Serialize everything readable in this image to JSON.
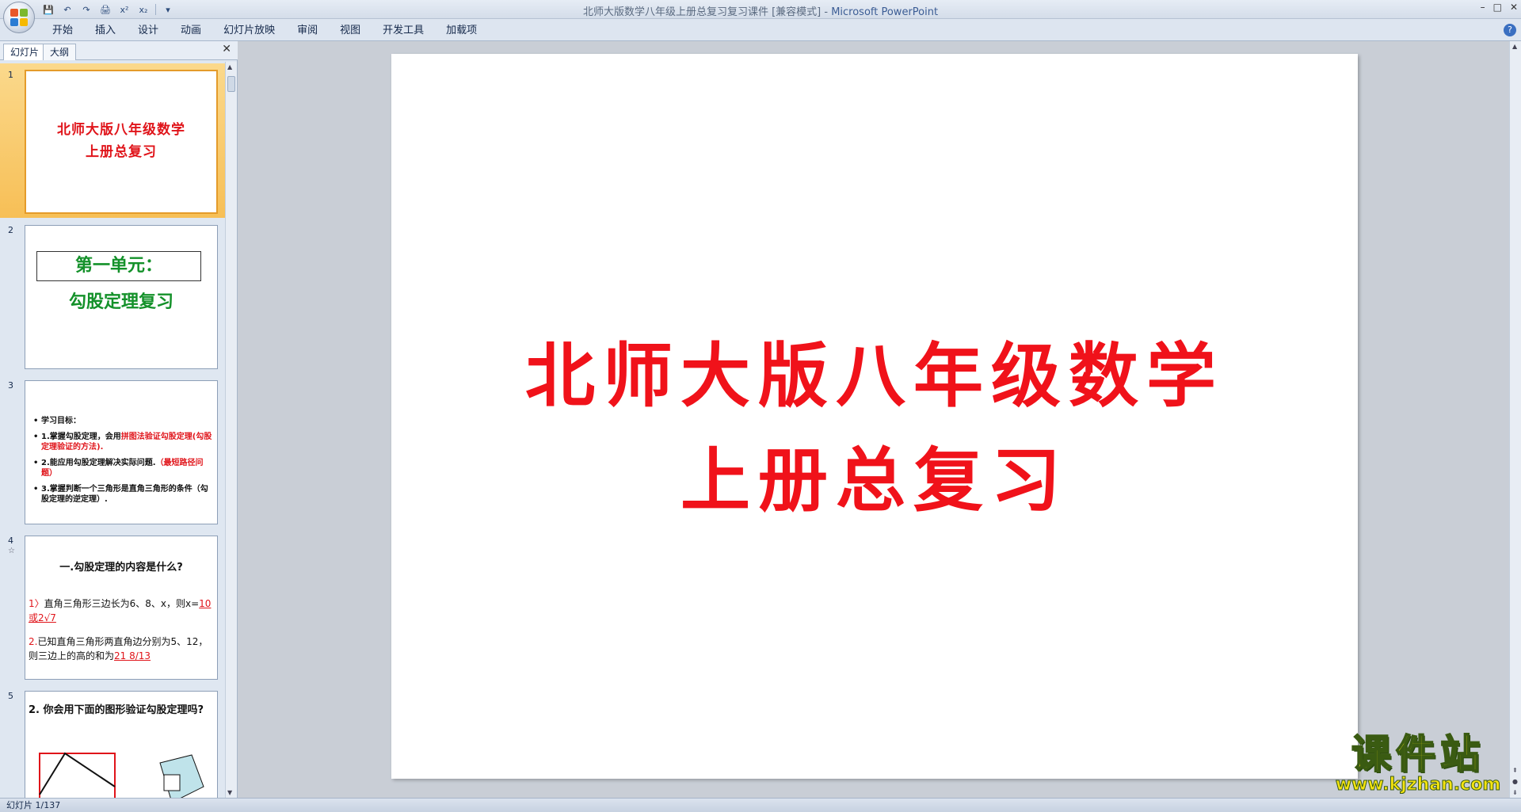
{
  "window": {
    "title": "北师大版数学八年级上册总复习复习课件 [兼容模式]",
    "app_name": "Microsoft PowerPoint",
    "controls": [
      "–",
      "□",
      "✕"
    ]
  },
  "ribbon": {
    "tabs": [
      "开始",
      "插入",
      "设计",
      "动画",
      "幻灯片放映",
      "审阅",
      "视图",
      "开发工具",
      "加载项"
    ]
  },
  "left_pane": {
    "tabs": [
      "幻灯片",
      "大纲"
    ],
    "close": "✕"
  },
  "thumbs": [
    {
      "num": "1",
      "line1": "北师大版八年级数学",
      "line2": "上册总复习"
    },
    {
      "num": "2",
      "box": "第一单元：",
      "sub": "勾股定理复习"
    },
    {
      "num": "3",
      "items": [
        {
          "a": "学习目标："
        },
        {
          "a": "1.掌握勾股定理，会用",
          "r": "拼图法验证勾股定理(勾股定理验证的方法)."
        },
        {
          "a": "2.能应用勾股定理解决实际问题.",
          "r": "（最短路径问题）"
        },
        {
          "a": "3.掌握判断一个三角形是直角三角形的条件（勾股定理的逆定理）."
        }
      ]
    },
    {
      "num": "4",
      "star": "☆",
      "q": "一.勾股定理的内容是什么?",
      "a1n": "1〉",
      "a1": "直角三角形三边长为6、8、x，则x=",
      "a1ans": "10或2√7",
      "a2n": "2.",
      "a2": "已知直角三角形两直角边分别为5、12，则三边上的高的和为",
      "a2ans": "21 8/13"
    },
    {
      "num": "5",
      "q": "2. 你会用下面的图形验证勾股定理吗?"
    }
  ],
  "slide": {
    "line1": "北师大版八年级数学",
    "line2": "上册总复习"
  },
  "status": {
    "text": "幻灯片 1/137"
  },
  "watermark": {
    "cn": "课件站",
    "url": "www.kjzhan.com"
  }
}
